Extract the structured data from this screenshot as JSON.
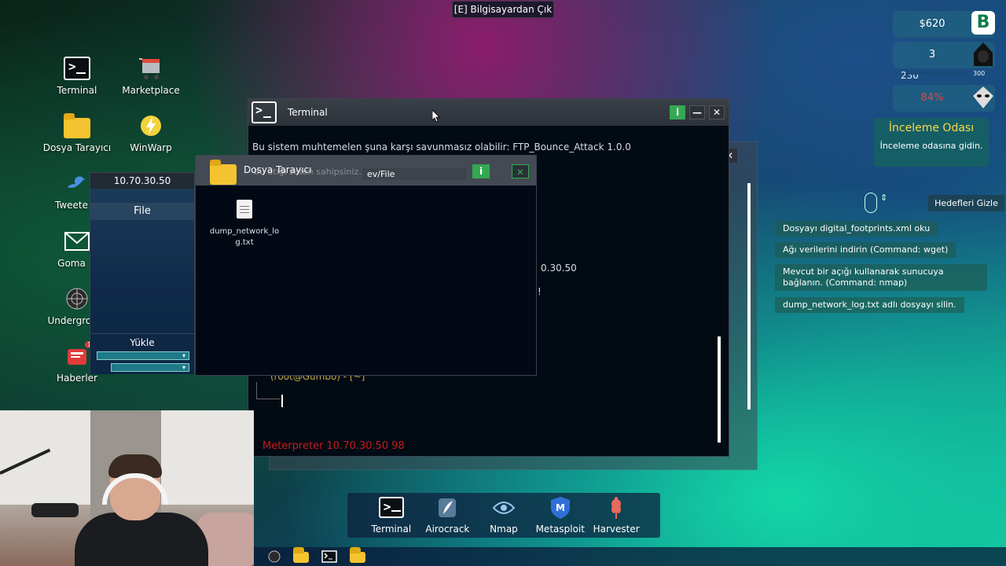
{
  "exit_hint": "[E] Bilgisayardan Çık",
  "desktop": {
    "icons": [
      {
        "label": "Terminal",
        "icon": "terminal-icon"
      },
      {
        "label": "Marketplace",
        "icon": "cart-icon"
      },
      {
        "label": "Dosya Tarayıcı",
        "icon": "folder-icon"
      },
      {
        "label": "WinWarp",
        "icon": "lightning-icon"
      },
      {
        "label": "Tweete",
        "icon": "bird-icon"
      },
      {
        "label": "Goma",
        "icon": "mail-icon"
      },
      {
        "label": "Undergroun",
        "icon": "web-icon"
      },
      {
        "label": "Haberler",
        "icon": "news-icon"
      }
    ],
    "news_badge": "11"
  },
  "terminal_window": {
    "title": "Terminal",
    "info_label": "i",
    "minimize_label": "—",
    "close_label": "✕",
    "lines": {
      "vuln": "Bu sistem muhtemelen şuna karşı savunmasız olabilir: FTP_Bounce_Attack 1.0.0",
      "partial_ip": "0.30.50",
      "partial_bang": "!",
      "prompt": "(root@Gumbo) - [~]"
    },
    "meterpreter": "Meterpreter 10.70.30.50   98"
  },
  "file_browser": {
    "title": "Dosya Tarayıcı",
    "ghost_text": "bu atığı zaten sahipsiniz.",
    "path": "ev/File",
    "info_label": "i",
    "close_label": "✕",
    "files": [
      {
        "name": "dump_network_log.txt",
        "icon": "document-icon"
      }
    ]
  },
  "upload_panel": {
    "ip": "10.70.30.50",
    "folder": "File",
    "upload_label": "Yükle",
    "select_arrow": "▾"
  },
  "hud": {
    "money": "$620",
    "level": "3",
    "xp_min": "230",
    "xp_max": "300",
    "xp_fraction": 1.0,
    "percent": "84%",
    "brand_badge": "B"
  },
  "room": {
    "title": "İnceleme Odası",
    "subtitle": "İnceleme odasına gidin."
  },
  "hide_goals_label": "Hedefleri Gizle",
  "goals": [
    "Dosyayı digital_footprints.xml oku",
    "Ağı verilerini indirin (Command: wget)",
    "Mevcut bir açığı kullanarak sunucuya bağlanın. (Command: nmap)",
    "dump_network_log.txt adlı dosyayı silin."
  ],
  "dock": [
    {
      "label": "Terminal",
      "icon": "terminal-icon"
    },
    {
      "label": "Airocrack",
      "icon": "feather-icon"
    },
    {
      "label": "Nmap",
      "icon": "eye-icon"
    },
    {
      "label": "Metasploit",
      "icon": "shield-m-icon"
    },
    {
      "label": "Harvester",
      "icon": "wheat-icon"
    }
  ],
  "colors": {
    "accent_green": "#34a853",
    "meterpreter_red": "#c41d1d",
    "room_title": "#f7d84a"
  }
}
